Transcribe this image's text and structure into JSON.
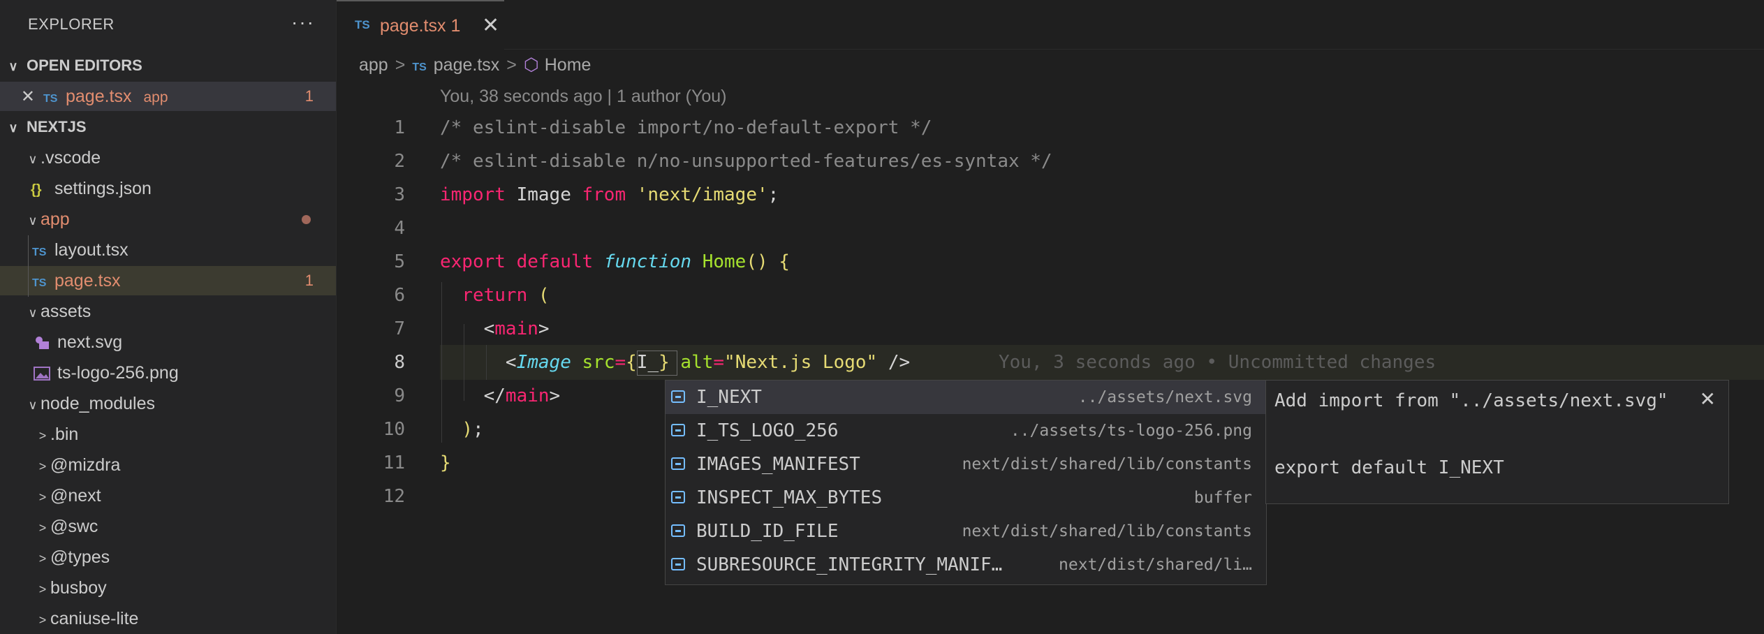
{
  "sidebar": {
    "title": "EXPLORER",
    "more": "···",
    "open_editors": {
      "header": "OPEN EDITORS",
      "items": [
        {
          "close": "✕",
          "type": "TS",
          "name": "page.tsx",
          "folder": "app",
          "badge": "1"
        }
      ]
    },
    "project": {
      "header": "NEXTJS",
      "rows": [
        {
          "chev": "∨",
          "name": ".vscode"
        },
        {
          "type": "{}",
          "name": "settings.json"
        },
        {
          "chev": "∨",
          "name": "app"
        },
        {
          "type": "TS",
          "name": "layout.tsx"
        },
        {
          "type": "TS",
          "name": "page.tsx",
          "badge": "1"
        },
        {
          "chev": "∨",
          "name": "assets"
        },
        {
          "name": "next.svg"
        },
        {
          "name": "ts-logo-256.png"
        },
        {
          "chev": "∨",
          "name": "node_modules"
        },
        {
          "chev": ">",
          "name": ".bin"
        },
        {
          "chev": ">",
          "name": "@mizdra"
        },
        {
          "chev": ">",
          "name": "@next"
        },
        {
          "chev": ">",
          "name": "@swc"
        },
        {
          "chev": ">",
          "name": "@types"
        },
        {
          "chev": ">",
          "name": "busboy"
        },
        {
          "chev": ">",
          "name": "caniuse-lite"
        }
      ]
    }
  },
  "tab": {
    "type": "TS",
    "name": "page.tsx 1",
    "close": "✕"
  },
  "breadcrumb": {
    "folder": "app",
    "file_type": "TS",
    "file": "page.tsx",
    "symbol": "Home",
    "sep": ">"
  },
  "blame": "You, 38 seconds ago | 1 author (You)",
  "editor": {
    "line_numbers": [
      "1",
      "2",
      "3",
      "4",
      "5",
      "6",
      "7",
      "8",
      "9",
      "10",
      "11",
      "12"
    ],
    "inline_blame": "You, 3 seconds ago • Uncommitted changes"
  },
  "suggest": {
    "items": [
      {
        "label": "I_NEXT",
        "detail": "../assets/next.svg"
      },
      {
        "label": "I_TS_LOGO_256",
        "detail": "../assets/ts-logo-256.png"
      },
      {
        "label": "IMAGES_MANIFEST",
        "detail": "next/dist/shared/lib/constants"
      },
      {
        "label": "INSPECT_MAX_BYTES",
        "detail": "buffer"
      },
      {
        "label": "BUILD_ID_FILE",
        "detail": "next/dist/shared/lib/constants"
      },
      {
        "label": "SUBRESOURCE_INTEGRITY_MANIF…",
        "detail": "next/dist/shared/li…"
      }
    ]
  },
  "details": {
    "line1": "Add import from \"../assets/next.svg\"",
    "line2": "export default I_NEXT",
    "close": "✕"
  },
  "colors": {
    "accent_ts": "#4e94ce",
    "modified": "#e28d6f",
    "keyword": "#f92672",
    "string": "#e6db74",
    "function": "#a6e22e"
  }
}
